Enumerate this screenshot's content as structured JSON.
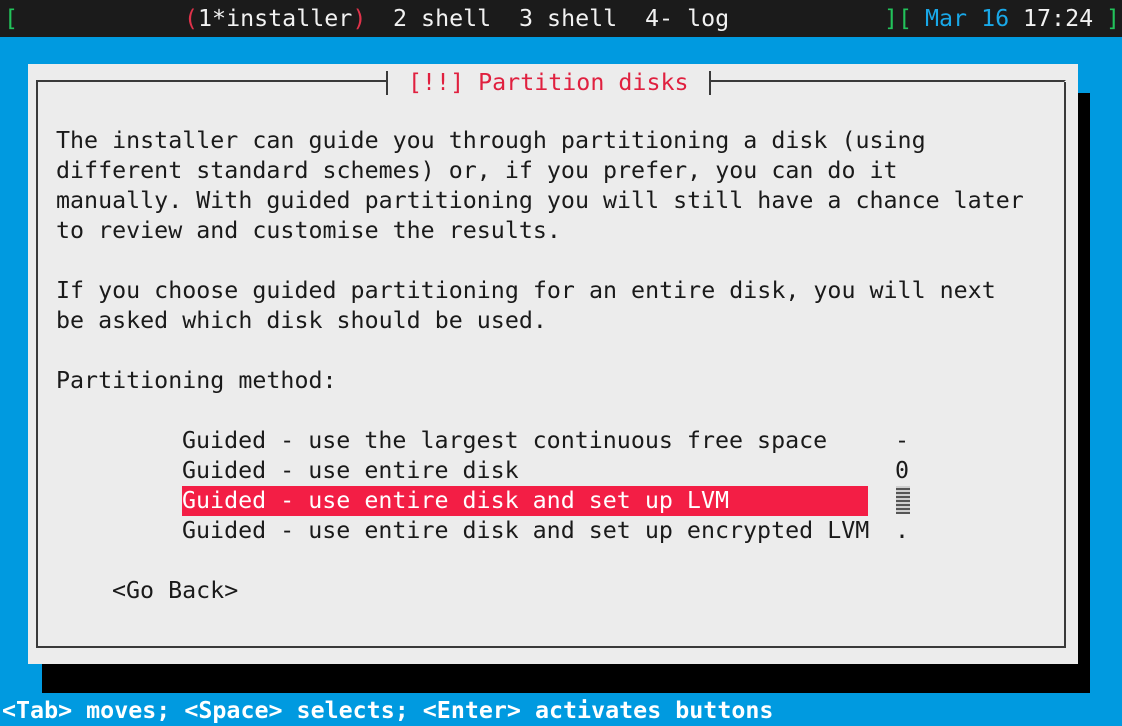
{
  "tmux": {
    "open_bracket": "[",
    "win_active": "(1*installer)",
    "win_active_left": "(",
    "win_active_name": "1*installer",
    "win_active_right": ")",
    "win2": "2 shell",
    "win3": "3 shell",
    "win4": "4- log",
    "status_left_bracket": "][",
    "date": "Mar 16",
    "time": "17:24",
    "status_right_bracket": "]"
  },
  "dialog": {
    "title": "[!!] Partition disks",
    "paragraph1": [
      "The installer can guide you through partitioning a disk (using",
      "different standard schemes) or, if you prefer, you can do it",
      "manually. With guided partitioning you will still have a chance later",
      "to review and customise the results."
    ],
    "paragraph2": [
      "If you choose guided partitioning for an entire disk, you will next",
      "be asked which disk should be used."
    ],
    "method_label": "Partitioning method:",
    "options": [
      "Guided - use the largest continuous free space",
      "Guided - use entire disk",
      "Guided - use entire disk and set up LVM",
      "Guided - use entire disk and set up encrypted LVM"
    ],
    "selected_index": 2,
    "scroll_top": "-",
    "scroll_mid": "0",
    "scroll_bottom": ".",
    "go_back": "<Go Back>"
  },
  "help_line": "<Tab> moves; <Space> selects; <Enter> activates buttons",
  "colors": {
    "background": "#009ae0",
    "dialog_bg": "#ececec",
    "title": "#e0203f",
    "selection": "#f31e45",
    "tmux_bar": "#1b1b1b"
  }
}
